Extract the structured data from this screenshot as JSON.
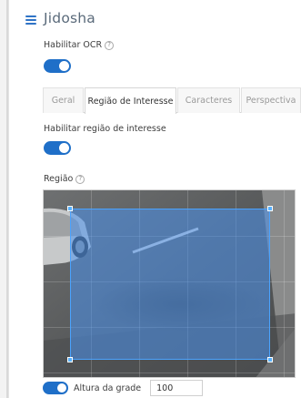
{
  "header": {
    "title": "Jidosha",
    "menu_icon": "list-icon"
  },
  "ocr": {
    "label": "Habilitar OCR",
    "enabled": true
  },
  "tabs": [
    {
      "label": "Geral",
      "active": false
    },
    {
      "label": "Região de Interesse",
      "active": true
    },
    {
      "label": "Caracteres",
      "active": false
    },
    {
      "label": "Perspectiva",
      "active": false
    }
  ],
  "roi_toggle": {
    "label": "Habilitar região de interesse",
    "enabled": true
  },
  "region": {
    "label": "Região",
    "help_icon": "help-circle-icon"
  },
  "grid": {
    "toggle_enabled": true,
    "label": "Altura da grade",
    "value": "100"
  },
  "colors": {
    "accent": "#1f6fc8",
    "roi_fill": "#4a92ec"
  }
}
